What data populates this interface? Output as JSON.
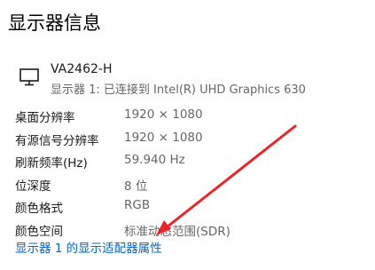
{
  "page": {
    "title": "显示器信息"
  },
  "monitor": {
    "icon": "monitor-icon",
    "name": "VA2462-H",
    "subtitle": "显示器 1: 已连接到 Intel(R) UHD Graphics 630"
  },
  "info": {
    "rows": [
      {
        "label": "桌面分辨率",
        "value": "1920 × 1080"
      },
      {
        "label": "有源信号分辨率",
        "value": "1920 × 1080"
      },
      {
        "label": "刷新频率(Hz)",
        "value": "59.940 Hz"
      },
      {
        "label": "位深度",
        "value": "8 位"
      },
      {
        "label": "颜色格式",
        "value": "RGB"
      },
      {
        "label": "颜色空间",
        "value": "标准动态范围(SDR)"
      }
    ]
  },
  "link": {
    "adapter_properties": "显示器 1 的显示适配器属性"
  },
  "annotation": {
    "arrow_color": "#e8262a"
  },
  "colors": {
    "link": "#0067c0",
    "secondary_text": "#666666"
  }
}
